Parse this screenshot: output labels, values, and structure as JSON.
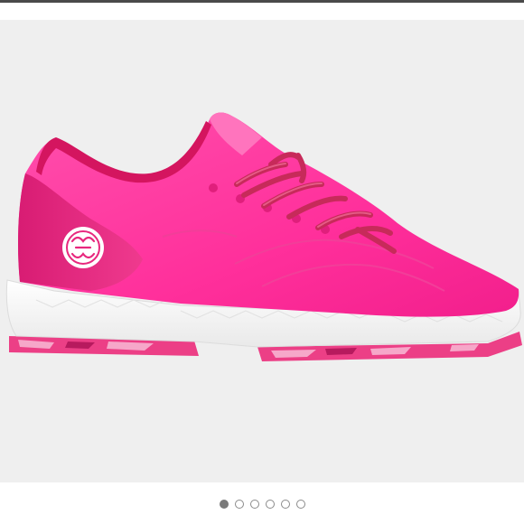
{
  "product_image": {
    "subject": "sneaker-photo",
    "colors": {
      "upper": "#ff2f9b",
      "upper_light": "#ff6fbb",
      "heel": "#e8287e",
      "collar": "#d4155f",
      "laces": "#c72a5a",
      "sole": "#f7f7f7",
      "outsole_camo": "#ec3f86",
      "background": "#efefef"
    },
    "logo_text": "GG"
  },
  "pager": {
    "dot_count": 6,
    "active_index": 0
  }
}
